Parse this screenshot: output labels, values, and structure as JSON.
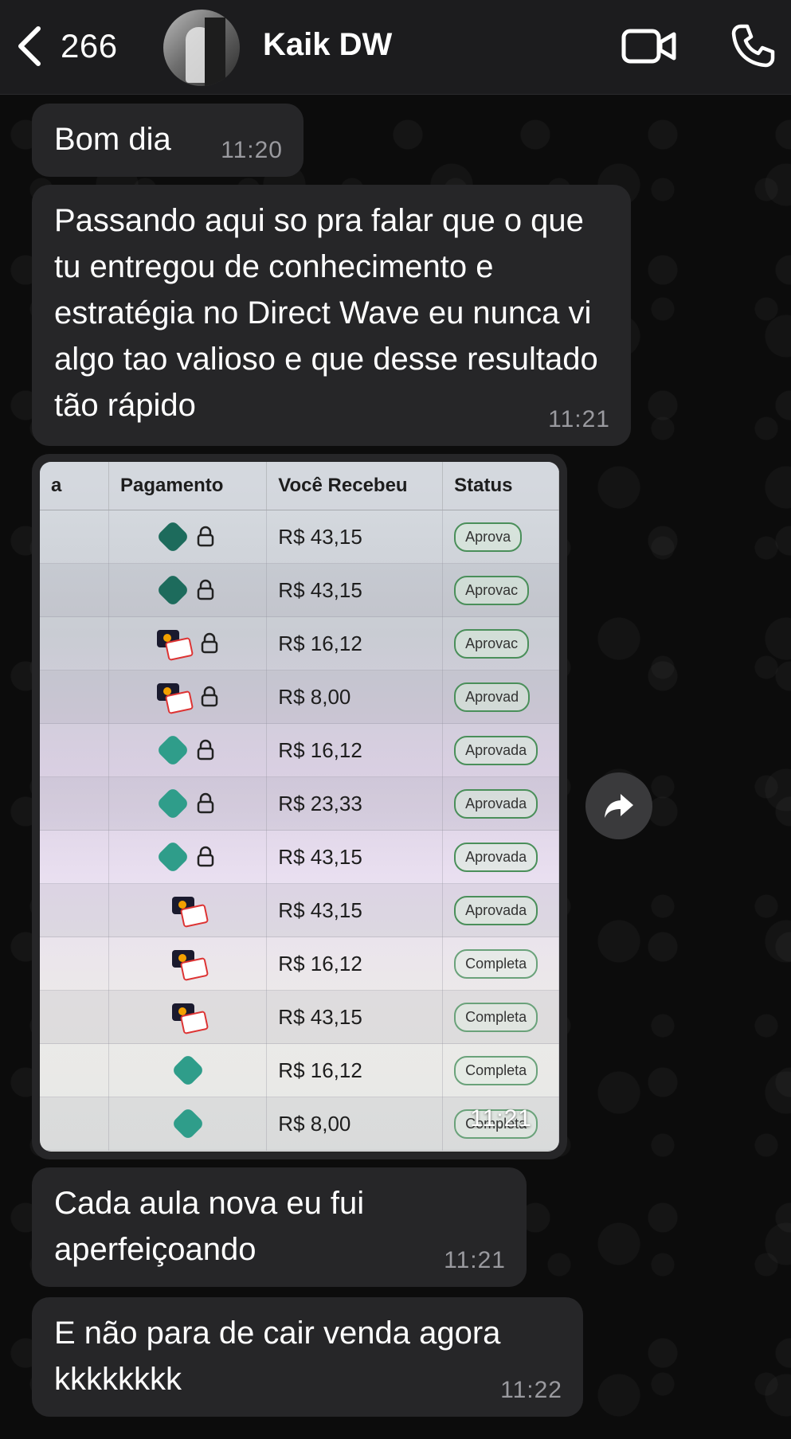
{
  "header": {
    "back_count": "266",
    "contact_name": "Kaik DW"
  },
  "messages": [
    {
      "text": "Bom dia",
      "time": "11:20"
    },
    {
      "text": "Passando aqui so pra falar que o que tu entregou de conhecimento e estratégia no Direct Wave eu nunca vi algo tao valioso e que desse resultado tão rápido",
      "time": "11:21"
    },
    {
      "type": "image",
      "time": "11:21"
    },
    {
      "text": "Cada aula nova eu fui aperfeiçoando",
      "time": "11:21"
    },
    {
      "text": "E não para de cair venda agora kkkkkkkk",
      "time": "11:22"
    }
  ],
  "photo_table": {
    "headers": [
      "a",
      "Pagamento",
      "Você Recebeu",
      "Status"
    ],
    "rows": [
      {
        "method": "pix",
        "value": "R$ 43,15",
        "status": "Aprova"
      },
      {
        "method": "pix",
        "value": "R$ 43,15",
        "status": "Aprovac"
      },
      {
        "method": "card",
        "value": "R$ 16,12",
        "status": "Aprovac"
      },
      {
        "method": "card",
        "value": "R$ 8,00",
        "status": "Aprovad"
      },
      {
        "method": "pix",
        "value": "R$ 16,12",
        "status": "Aprovada"
      },
      {
        "method": "pix",
        "value": "R$ 23,33",
        "status": "Aprovada"
      },
      {
        "method": "pix",
        "value": "R$ 43,15",
        "status": "Aprovada"
      },
      {
        "method": "card",
        "value": "R$ 43,15",
        "status": "Aprovada"
      },
      {
        "method": "card",
        "value": "R$ 16,12",
        "status": "Completa"
      },
      {
        "method": "card",
        "value": "R$ 43,15",
        "status": "Completa"
      },
      {
        "method": "pix",
        "value": "R$ 16,12",
        "status": "Completa"
      },
      {
        "method": "pix",
        "value": "R$ 8,00",
        "status": "Completa"
      }
    ]
  },
  "colors": {
    "header_bg": "#1c1c1e",
    "bubble_bg": "#262628",
    "time_color": "#9a9a9f",
    "pix_green": "#2f9d8a"
  }
}
